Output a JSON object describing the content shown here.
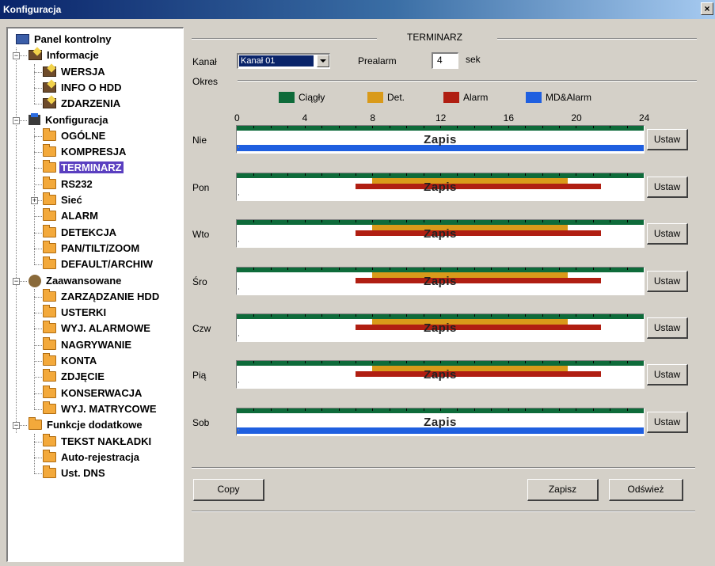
{
  "window": {
    "title": "Konfiguracja",
    "close_glyph": "×"
  },
  "tree": {
    "nodes": [
      {
        "label": "Panel kontrolny",
        "icon": "monitor-icon"
      },
      {
        "label": "Informacje",
        "icon": "info-icon",
        "expander": "−"
      },
      {
        "label": "WERSJA",
        "icon": "document-icon"
      },
      {
        "label": "INFO O HDD",
        "icon": "document-icon"
      },
      {
        "label": "ZDARZENIA",
        "icon": "document-icon"
      },
      {
        "label": "Konfiguracja",
        "icon": "tools-icon",
        "expander": "−"
      },
      {
        "label": "OGÓLNE",
        "icon": "folder-icon"
      },
      {
        "label": "KOMPRESJA",
        "icon": "folder-icon"
      },
      {
        "label": "TERMINARZ",
        "icon": "folder-icon",
        "selected": true
      },
      {
        "label": "RS232",
        "icon": "folder-icon"
      },
      {
        "label": "Sieć",
        "icon": "folder-icon",
        "expander": "+"
      },
      {
        "label": "ALARM",
        "icon": "folder-icon"
      },
      {
        "label": "DETEKCJA",
        "icon": "folder-icon"
      },
      {
        "label": "PAN/TILT/ZOOM",
        "icon": "folder-icon"
      },
      {
        "label": "DEFAULT/ARCHIW",
        "icon": "folder-icon"
      },
      {
        "label": "Zaawansowane",
        "icon": "gears-icon",
        "expander": "−"
      },
      {
        "label": "ZARZĄDZANIE HDD",
        "icon": "folder-icon"
      },
      {
        "label": "USTERKI",
        "icon": "folder-icon"
      },
      {
        "label": "WYJ. ALARMOWE",
        "icon": "folder-icon"
      },
      {
        "label": "NAGRYWANIE",
        "icon": "folder-icon"
      },
      {
        "label": "KONTA",
        "icon": "folder-icon"
      },
      {
        "label": "ZDJĘCIE",
        "icon": "folder-icon"
      },
      {
        "label": "KONSERWACJA",
        "icon": "folder-icon"
      },
      {
        "label": "WYJ. MATRYCOWE",
        "icon": "folder-icon"
      },
      {
        "label": "Funkcje dodatkowe",
        "icon": "folder-icon",
        "expander": "−"
      },
      {
        "label": "TEKST NAKŁADKI",
        "icon": "folder-icon"
      },
      {
        "label": "Auto-rejestracja",
        "icon": "folder-icon"
      },
      {
        "label": "Ust. DNS",
        "icon": "folder-icon"
      }
    ]
  },
  "panel": {
    "section_title": "TERMINARZ",
    "channel_label": "Kanał",
    "channel_value": "Kanał 01",
    "prealarm_label": "Prealarm",
    "prealarm_value": "4",
    "prealarm_unit": "sek",
    "period_label": "Okres"
  },
  "legend": [
    {
      "label": "Ciągły",
      "color": "#0e6b3a"
    },
    {
      "label": "Det.",
      "color": "#d99a1a"
    },
    {
      "label": "Alarm",
      "color": "#b01e12"
    },
    {
      "label": "MD&Alarm",
      "color": "#1f5fe0"
    }
  ],
  "axis_ticks": [
    "0",
    "4",
    "8",
    "12",
    "16",
    "20",
    "24"
  ],
  "schedule": {
    "bar_text": "Zapis",
    "set_label": "Ustaw",
    "days": [
      {
        "label": "Nie",
        "segments": [
          {
            "type": "Ciągły",
            "start": 0,
            "end": 24
          },
          {
            "type": "MD&Alarm",
            "start": 0,
            "end": 24
          }
        ]
      },
      {
        "label": "Pon",
        "segments": [
          {
            "type": "Ciągły",
            "start": 0,
            "end": 24
          },
          {
            "type": "Det.",
            "start": 8,
            "end": 19.5
          },
          {
            "type": "Alarm",
            "start": 7,
            "end": 21.5
          }
        ]
      },
      {
        "label": "Wto",
        "segments": [
          {
            "type": "Ciągły",
            "start": 0,
            "end": 24
          },
          {
            "type": "Det.",
            "start": 8,
            "end": 19.5
          },
          {
            "type": "Alarm",
            "start": 7,
            "end": 21.5
          }
        ]
      },
      {
        "label": "Śro",
        "segments": [
          {
            "type": "Ciągły",
            "start": 0,
            "end": 24
          },
          {
            "type": "Det.",
            "start": 8,
            "end": 19.5
          },
          {
            "type": "Alarm",
            "start": 7,
            "end": 21.5
          }
        ]
      },
      {
        "label": "Czw",
        "segments": [
          {
            "type": "Ciągły",
            "start": 0,
            "end": 24
          },
          {
            "type": "Det.",
            "start": 8,
            "end": 19.5
          },
          {
            "type": "Alarm",
            "start": 7,
            "end": 21.5
          }
        ]
      },
      {
        "label": "Pią",
        "segments": [
          {
            "type": "Ciągły",
            "start": 0,
            "end": 24
          },
          {
            "type": "Det.",
            "start": 8,
            "end": 19.5
          },
          {
            "type": "Alarm",
            "start": 7,
            "end": 21.5
          }
        ]
      },
      {
        "label": "Sob",
        "segments": [
          {
            "type": "Ciągły",
            "start": 0,
            "end": 24
          },
          {
            "type": "MD&Alarm",
            "start": 0,
            "end": 24
          }
        ]
      }
    ]
  },
  "buttons": {
    "copy": "Copy",
    "save": "Zapisz",
    "refresh": "Odśwież"
  }
}
